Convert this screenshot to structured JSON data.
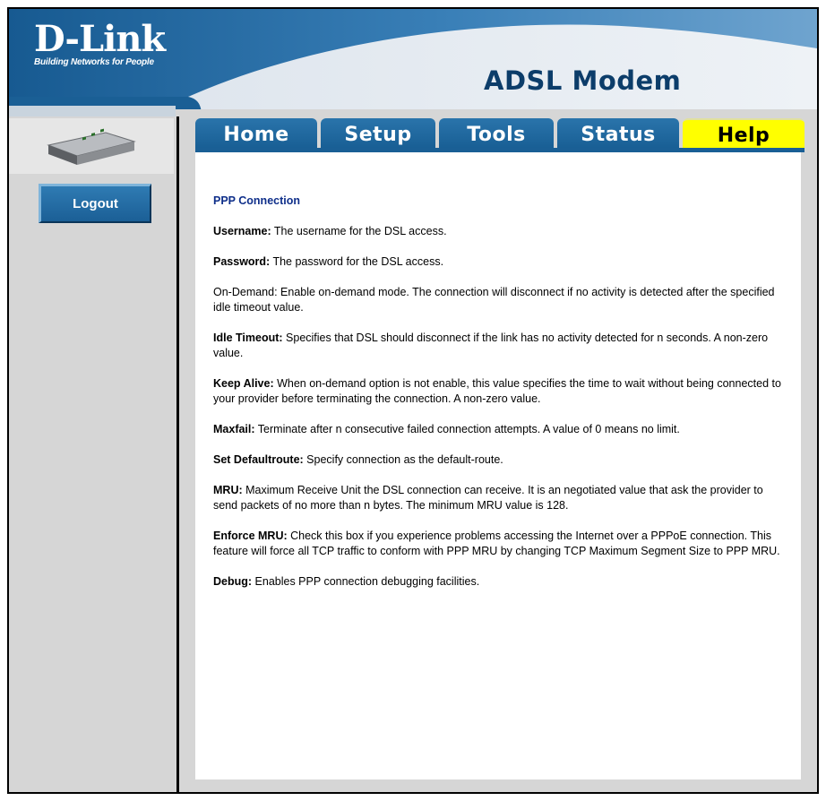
{
  "brand": {
    "logo": "D-Link",
    "tagline": "Building Networks for People",
    "product": "ADSL Modem",
    "colors": {
      "header_blue": "#1a5f95",
      "active_tab": "#ffff00",
      "title_blue": "#0f2f8a"
    }
  },
  "sidebar": {
    "device_image": "adsl-modem-device",
    "logout_label": "Logout"
  },
  "tabs": [
    {
      "label": "Home",
      "active": false
    },
    {
      "label": "Setup",
      "active": false
    },
    {
      "label": "Tools",
      "active": false
    },
    {
      "label": "Status",
      "active": false
    },
    {
      "label": "Help",
      "active": true
    }
  ],
  "help": {
    "title": "PPP Connection",
    "items": [
      {
        "term": "Username:",
        "text": " The username for the DSL access."
      },
      {
        "term": "Password:",
        "text": " The password for the DSL access."
      },
      {
        "term": "",
        "text": "On-Demand: Enable on-demand mode. The connection will disconnect if no activity is detected after the specified idle timeout value."
      },
      {
        "term": "Idle Timeout:",
        "text": " Specifies that DSL should disconnect if the link has no activity detected for n seconds. A non-zero value."
      },
      {
        "term": "Keep Alive:",
        "text": " When on-demand option is not enable, this value specifies the time to wait without being connected to your provider before terminating the connection. A non-zero value."
      },
      {
        "term": "Maxfail:",
        "text": " Terminate after n consecutive failed connection attempts. A value of 0 means no limit."
      },
      {
        "term": "Set Defaultroute:",
        "text": " Specify connection as the default-route."
      },
      {
        "term": "MRU:",
        "text": " Maximum Receive Unit the DSL connection can receive. It is an negotiated value that ask the provider to send packets of no more than n bytes. The minimum MRU value is 128."
      },
      {
        "term": "Enforce MRU:",
        "text": " Check this box if you experience problems accessing the Internet over a PPPoE connection. This feature will force all TCP traffic to conform with PPP MRU by changing TCP Maximum Segment Size to PPP MRU."
      },
      {
        "term": "Debug:",
        "text": " Enables PPP connection debugging facilities."
      }
    ]
  }
}
